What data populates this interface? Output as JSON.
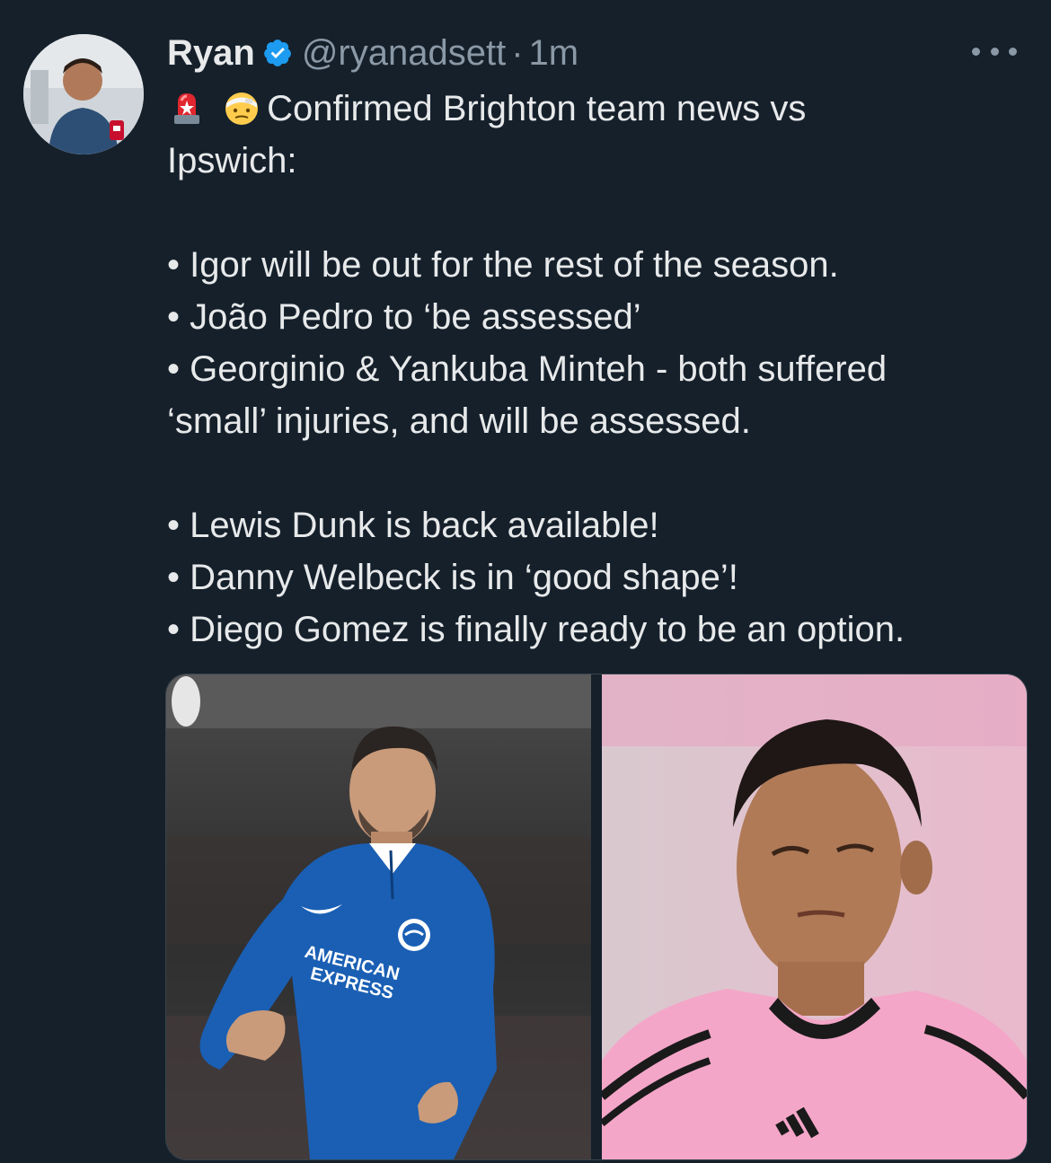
{
  "tweet": {
    "author": {
      "display_name": "Ryan",
      "handle": "@ryanadsett",
      "verified_icon": "verified-badge-icon",
      "avatar": "avatar-photo"
    },
    "separator": "·",
    "timestamp": "1m",
    "more_icon": "more-options-icon",
    "emojis": [
      "police-light-emoji",
      "bandaged-face-emoji"
    ],
    "lines": [
      "Confirmed Brighton team news vs",
      "Ipswich:",
      "",
      "• Igor will be out for the rest of the season.",
      "• João Pedro to ‘be assessed’",
      "• Georginio & Yankuba Minteh - both suffered",
      "‘small’ injuries, and will be assessed.",
      "",
      "• Lewis Dunk is back available!",
      "• Danny Welbeck is in ‘good shape’!",
      "• Diego Gomez is finally ready to be an option."
    ],
    "media": {
      "left_photo": {
        "jersey_text_1": "AMERICAN",
        "jersey_text_2": "EXPRESS"
      },
      "right_photo": {}
    }
  },
  "colors": {
    "background": "#15202b",
    "text": "#e7e9ea",
    "muted": "#8b98a5",
    "verified": "#1d9bf0",
    "brighton_blue": "#1a5fb4",
    "pink_kit": "#f4a6c8"
  }
}
